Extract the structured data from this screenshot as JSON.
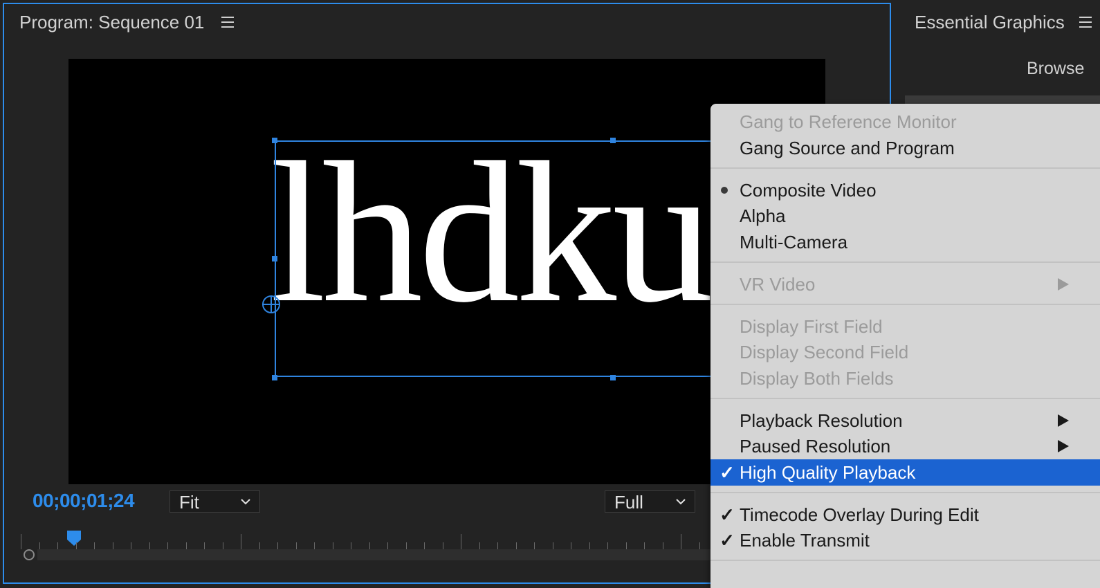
{
  "program_monitor": {
    "title": "Program: Sequence 01",
    "frame_text": "lhdku",
    "timecode": "00;00;01;24",
    "zoom_level": "Fit",
    "playback_resolution": "Full"
  },
  "essential_graphics": {
    "title": "Essential Graphics",
    "browse_tab": "Browse"
  },
  "context_menu": {
    "items": [
      {
        "label": "Gang to Reference Monitor",
        "enabled": false
      },
      {
        "label": "Gang Source and Program",
        "enabled": true
      },
      {
        "label": "Composite Video",
        "enabled": true,
        "selected": true
      },
      {
        "label": "Alpha",
        "enabled": true
      },
      {
        "label": "Multi-Camera",
        "enabled": true
      },
      {
        "label": "VR Video",
        "enabled": false,
        "submenu": true
      },
      {
        "label": "Display First Field",
        "enabled": false
      },
      {
        "label": "Display Second Field",
        "enabled": false
      },
      {
        "label": "Display Both Fields",
        "enabled": false
      },
      {
        "label": "Playback Resolution",
        "enabled": true,
        "submenu": true
      },
      {
        "label": "Paused Resolution",
        "enabled": true,
        "submenu": true
      },
      {
        "label": "High Quality Playback",
        "enabled": true,
        "checked": true,
        "highlighted": true
      },
      {
        "label": "Timecode Overlay During Edit",
        "enabled": true,
        "checked": true
      },
      {
        "label": "Enable Transmit",
        "enabled": true,
        "checked": true
      }
    ]
  },
  "colors": {
    "accent": "#2d8ceb",
    "menu_highlight": "#1b63d1",
    "menu_background": "#d5d5d5",
    "panel_background": "#232323"
  }
}
